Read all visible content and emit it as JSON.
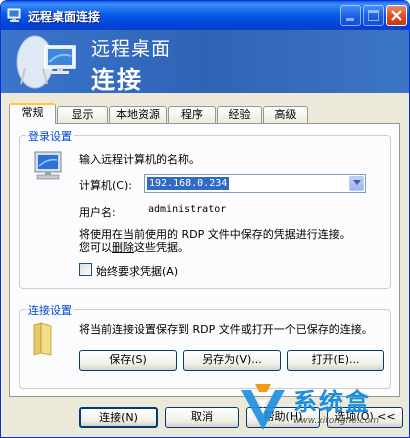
{
  "window": {
    "title": "远程桌面连接",
    "banner_line1": "远程桌面",
    "banner_line2": "连接",
    "minimize_glyph": "_",
    "maximize_glyph": "□",
    "close_glyph": "✕"
  },
  "tabs": [
    {
      "label": "常规",
      "active": true
    },
    {
      "label": "显示"
    },
    {
      "label": "本地资源"
    },
    {
      "label": "程序"
    },
    {
      "label": "经验"
    },
    {
      "label": "高级"
    }
  ],
  "login_settings": {
    "title": "登录设置",
    "prompt": "输入远程计算机的名称。",
    "computer_label": "计算机(C):",
    "computer_value": "192.168.0.234",
    "username_label": "用户名:",
    "username_value": "administrator",
    "creds_line1": "将使用在当前使用的 RDP 文件中保存的凭据进行连接。",
    "creds_line2_pre": "您可以",
    "creds_line2_link": "删除",
    "creds_line2_post": "这些凭据。",
    "always_ask_label": "始终要求凭据(A)",
    "always_ask_checked": false
  },
  "connection_settings": {
    "title": "连接设置",
    "description": "将当前连接设置保存到 RDP 文件或打开一个已保存的连接。",
    "save_button": "保存(S)",
    "save_as_button": "另存为(V)...",
    "open_button": "打开(E)..."
  },
  "footer": {
    "connect_button": "连接(N)",
    "cancel_button": "取消",
    "help_button": "帮助(H)",
    "options_button": "选项(O) <<"
  },
  "watermark": {
    "title": "系统盒",
    "url": "www.xitonghe.com"
  }
}
